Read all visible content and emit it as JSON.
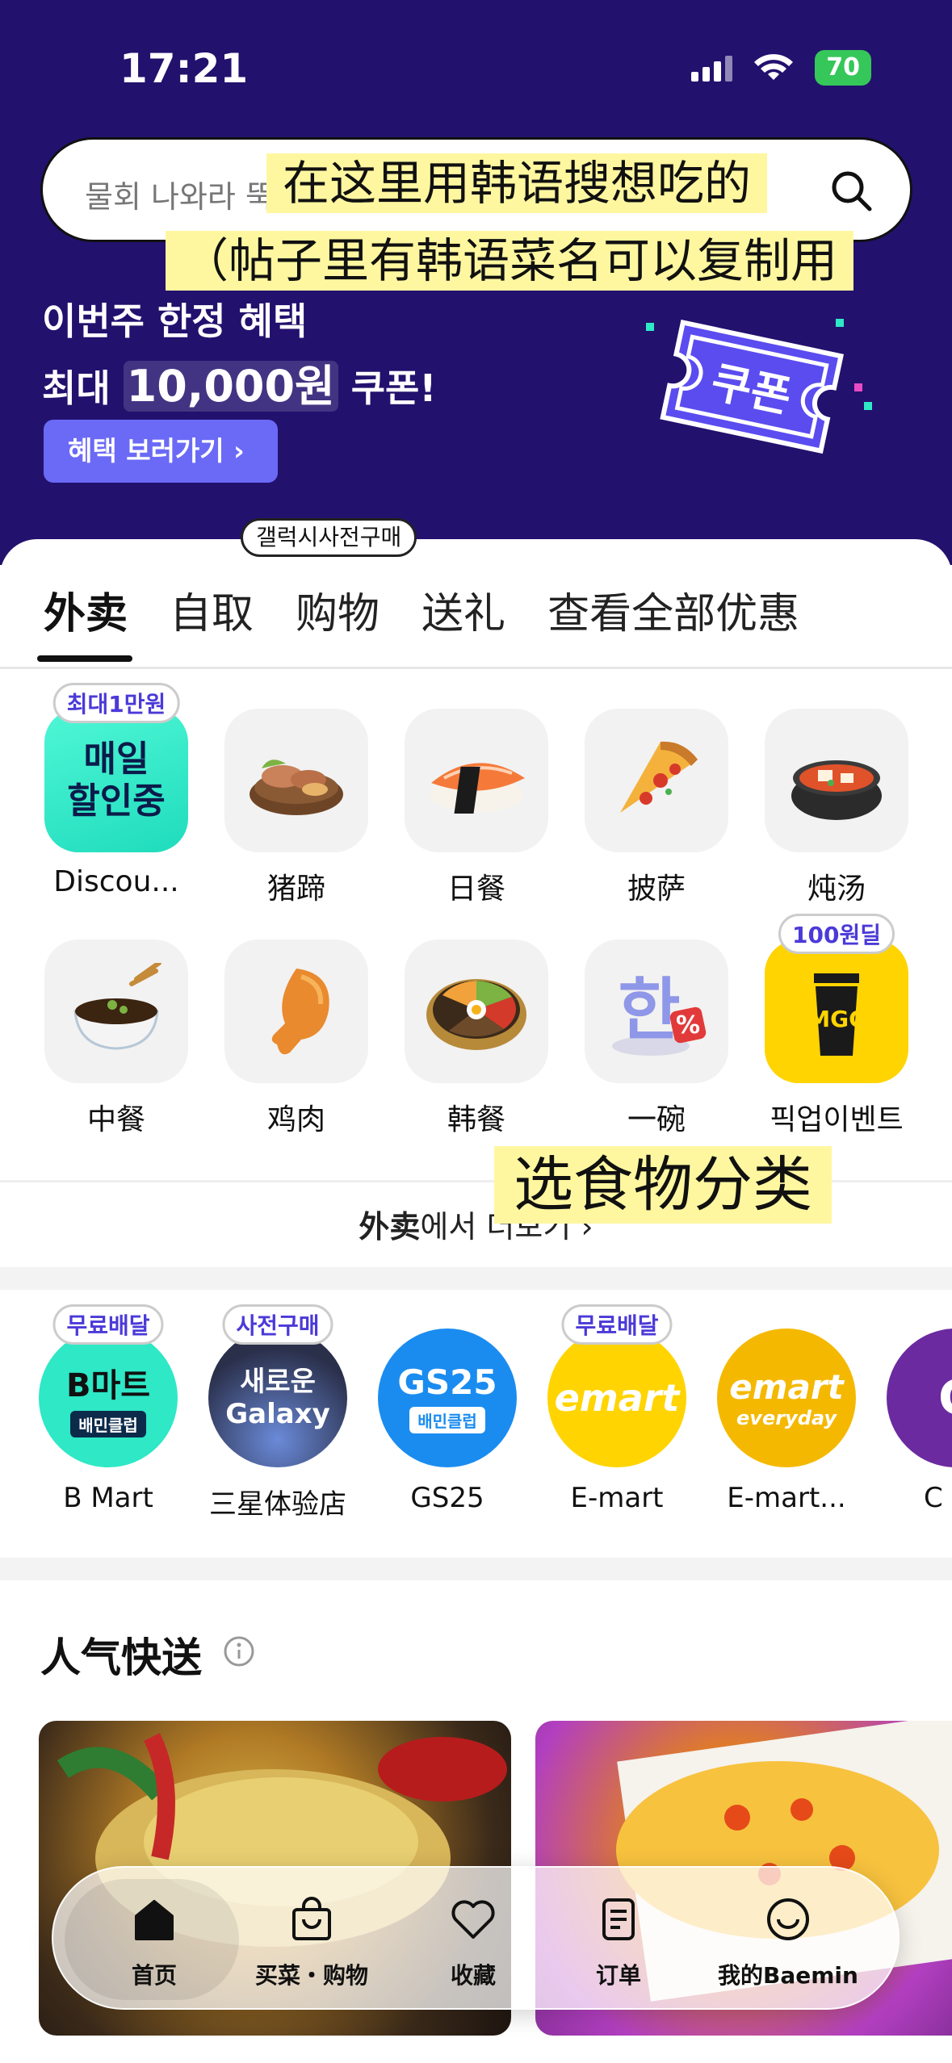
{
  "status_bar": {
    "time": "17:21",
    "battery": "70"
  },
  "search": {
    "placeholder": "물회 나와라 뚝"
  },
  "notes": {
    "search_hint_1": "在这里用韩语搜想吃的",
    "search_hint_2": "（帖子里有韩语菜名可以复制用",
    "category_hint": "选食物分类"
  },
  "promo": {
    "line1": "이번주 한정 혜택",
    "line2_prefix": "최대 ",
    "line2_amount": "10,000원",
    "line2_suffix": " 쿠폰!",
    "button_label": "혜택 보러가기",
    "coupon_text": "쿠폰"
  },
  "tabs": {
    "presale_tag": "갤럭시사전구매",
    "items": [
      "外卖",
      "自取",
      "购物",
      "送礼",
      "查看全部优惠"
    ]
  },
  "categories": [
    {
      "label": "Discou...",
      "icon": "daily-discount-icon",
      "badge": "최대1만원",
      "tile_text": "매일\n할인중"
    },
    {
      "label": "猪蹄",
      "icon": "pork-trotter-icon"
    },
    {
      "label": "日餐",
      "icon": "sushi-icon"
    },
    {
      "label": "披萨",
      "icon": "pizza-icon"
    },
    {
      "label": "炖汤",
      "icon": "stew-icon"
    },
    {
      "label": "中餐",
      "icon": "jajangmyeon-icon"
    },
    {
      "label": "鸡肉",
      "icon": "chicken-drumstick-icon"
    },
    {
      "label": "韩餐",
      "icon": "bibimbap-icon"
    },
    {
      "label": "一碗",
      "icon": "han-bowl-icon"
    },
    {
      "label": "픽업이벤트",
      "icon": "mgc-coffee-icon",
      "badge": "100원딜"
    }
  ],
  "more_link": {
    "bold": "外卖",
    "text": "에서 더보기"
  },
  "stores": [
    {
      "label": "B Mart",
      "badge": "무료배달",
      "logo": "B마트",
      "sub": "배민클럽"
    },
    {
      "label": "三星体验店",
      "badge": "사전구매",
      "logo": "새로운\nGalaxy"
    },
    {
      "label": "GS25",
      "logo": "GS25",
      "sub": "배민클럽"
    },
    {
      "label": "E-mart",
      "badge": "무료배달",
      "logo": "emart"
    },
    {
      "label": "E-mart...",
      "logo": "emart",
      "sub": "everyday"
    },
    {
      "label": "C",
      "logo": "C"
    }
  ],
  "popular": {
    "title": "人气快送"
  },
  "tabbar": {
    "items": [
      {
        "label": "首页",
        "icon": "home-icon"
      },
      {
        "label": "买菜・购物",
        "icon": "shopping-bag-icon"
      },
      {
        "label": "收藏",
        "icon": "heart-icon"
      },
      {
        "label": "订单",
        "icon": "orders-icon"
      },
      {
        "label": "我的Baemin",
        "icon": "profile-smile-icon"
      }
    ]
  },
  "colors": {
    "hero_bg": "#23116e",
    "accent": "#6b6af6",
    "baemin_mint": "#2ee8c6",
    "emart_yellow": "#ffd400"
  }
}
